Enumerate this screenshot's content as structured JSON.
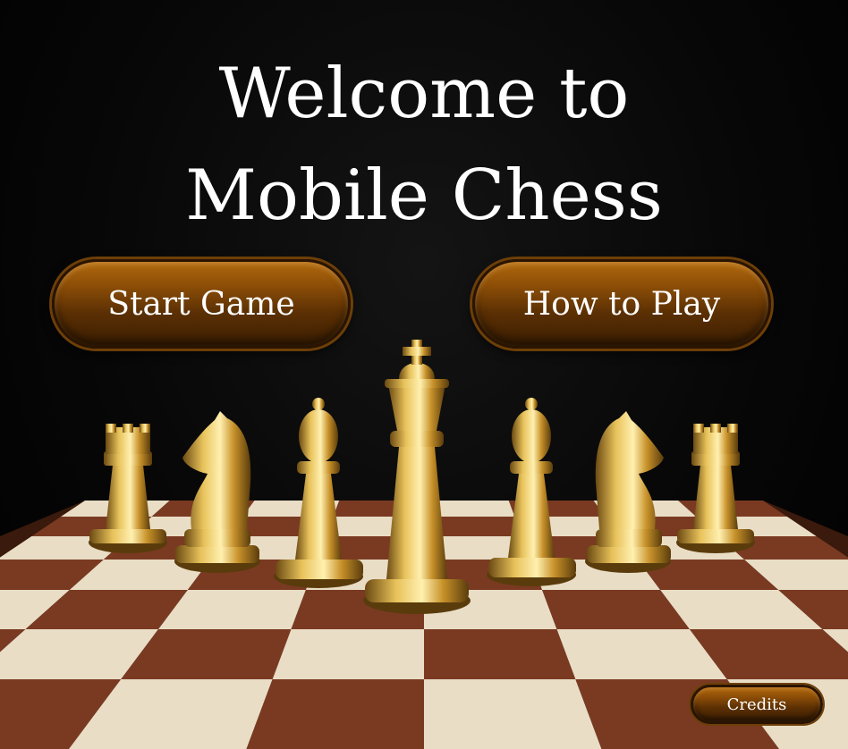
{
  "title": {
    "line1": "Welcome to",
    "line2": "Mobile Chess"
  },
  "buttons": {
    "start_label": "Start Game",
    "how_label": "How to Play",
    "credits_label": "Credits"
  },
  "colors": {
    "button_top": "#b0680d",
    "button_bottom": "#3c1e02",
    "gold": "#d4a12a",
    "board_light": "#e9ddc6",
    "board_dark": "#7a3a22"
  }
}
